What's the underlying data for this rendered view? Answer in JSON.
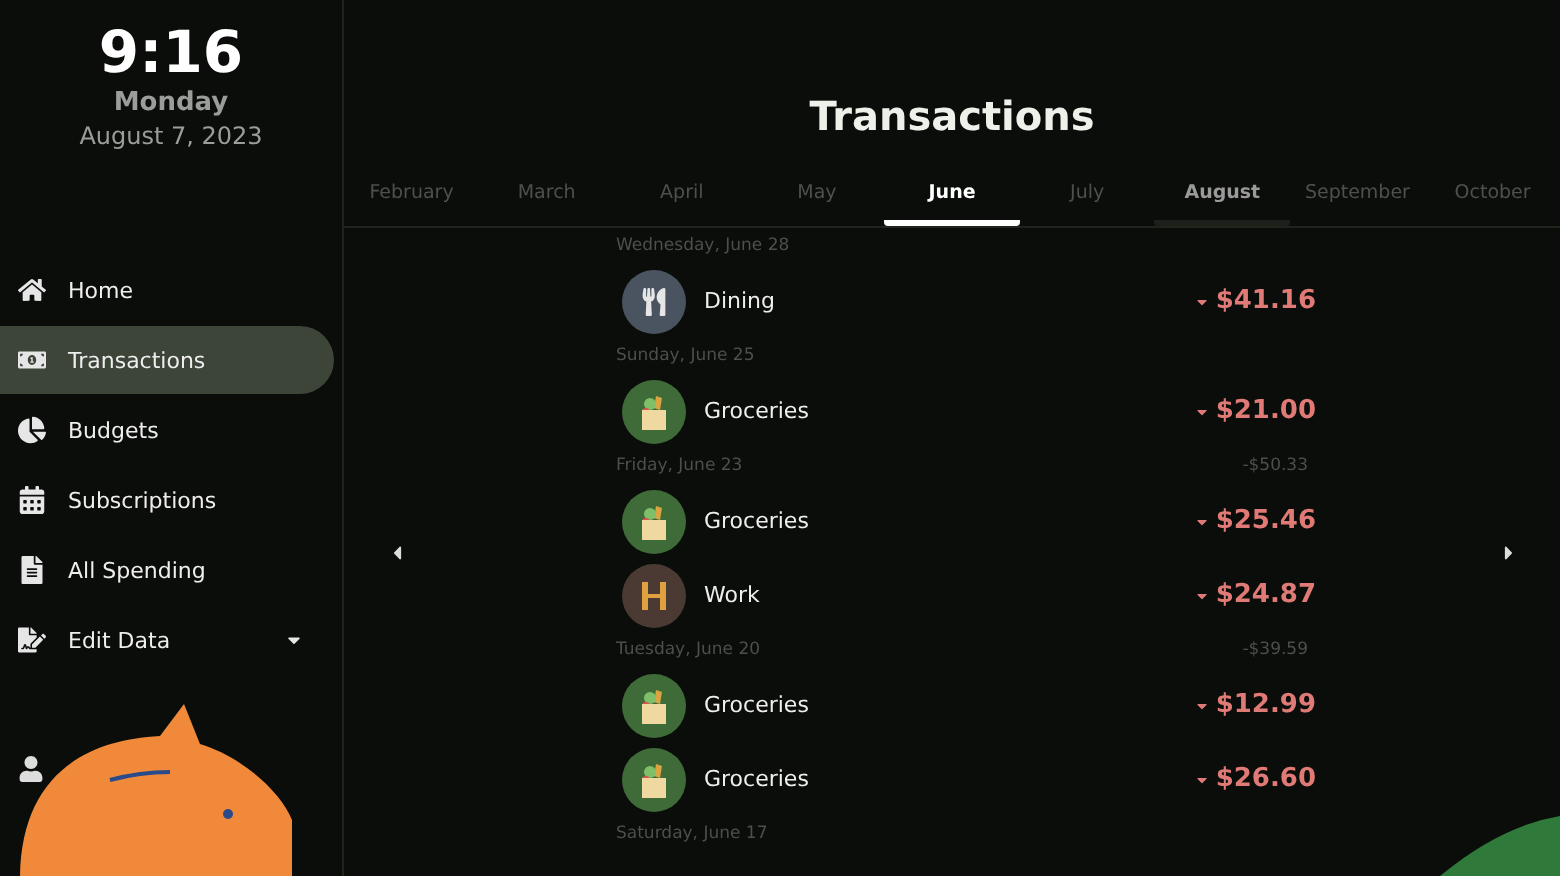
{
  "clock": {
    "time": "9:16",
    "weekday": "Monday",
    "date": "August 7, 2023"
  },
  "nav": [
    {
      "label": "Home",
      "selected": false,
      "dropdown": false
    },
    {
      "label": "Transactions",
      "selected": true,
      "dropdown": false
    },
    {
      "label": "Budgets",
      "selected": false,
      "dropdown": false
    },
    {
      "label": "Subscriptions",
      "selected": false,
      "dropdown": false
    },
    {
      "label": "All Spending",
      "selected": false,
      "dropdown": false
    },
    {
      "label": "Edit Data",
      "selected": false,
      "dropdown": true
    }
  ],
  "title": "Transactions",
  "months": [
    {
      "label": "February",
      "selected": false,
      "current": false
    },
    {
      "label": "March",
      "selected": false,
      "current": false
    },
    {
      "label": "April",
      "selected": false,
      "current": false
    },
    {
      "label": "May",
      "selected": false,
      "current": false
    },
    {
      "label": "June",
      "selected": true,
      "current": false
    },
    {
      "label": "July",
      "selected": false,
      "current": false
    },
    {
      "label": "August",
      "selected": false,
      "current": true
    },
    {
      "label": "September",
      "selected": false,
      "current": false
    },
    {
      "label": "October",
      "selected": false,
      "current": false
    }
  ],
  "groups": [
    {
      "date": "Wednesday, June 28",
      "items": [
        {
          "kind": "dining",
          "label": "Dining",
          "amount": "$41.16"
        }
      ]
    },
    {
      "date": "Sunday, June 25",
      "items": [
        {
          "kind": "groceries",
          "label": "Groceries",
          "amount": "$21.00"
        }
      ]
    },
    {
      "date": "Friday, June 23",
      "total": "-$50.33",
      "items": [
        {
          "kind": "groceries",
          "label": "Groceries",
          "amount": "$25.46"
        },
        {
          "kind": "work",
          "label": "Work",
          "amount": "$24.87"
        }
      ]
    },
    {
      "date": "Tuesday, June 20",
      "total": "-$39.59",
      "items": [
        {
          "kind": "groceries",
          "label": "Groceries",
          "amount": "$12.99"
        },
        {
          "kind": "groceries",
          "label": "Groceries",
          "amount": "$26.60"
        }
      ]
    },
    {
      "date": "Saturday, June 17"
    }
  ]
}
